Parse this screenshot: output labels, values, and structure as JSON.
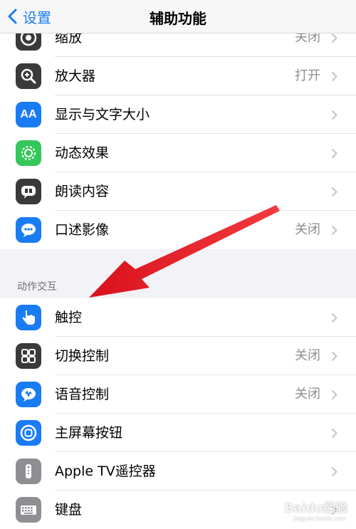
{
  "nav": {
    "back_label": "设置",
    "title": "辅助功能"
  },
  "colors": {
    "accent": "#1a7cf5",
    "arrow": "#e8202b"
  },
  "groups": {
    "vision": [
      {
        "label": "缩放",
        "value": "关闭",
        "icon": "zoom-icon"
      },
      {
        "label": "放大器",
        "value": "打开",
        "icon": "magnifier-icon"
      },
      {
        "label": "显示与文字大小",
        "value": "",
        "icon": "text-size-icon"
      },
      {
        "label": "动态效果",
        "value": "",
        "icon": "motion-icon"
      },
      {
        "label": "朗读内容",
        "value": "",
        "icon": "spoken-content-icon"
      },
      {
        "label": "口述影像",
        "value": "关闭",
        "icon": "audio-description-icon"
      }
    ],
    "interaction_header": "动作交互",
    "interaction": [
      {
        "label": "触控",
        "value": "",
        "icon": "touch-hand-icon"
      },
      {
        "label": "切换控制",
        "value": "关闭",
        "icon": "switch-control-icon"
      },
      {
        "label": "语音控制",
        "value": "关闭",
        "icon": "voice-control-icon"
      },
      {
        "label": "主屏幕按钮",
        "value": "",
        "icon": "home-button-icon"
      },
      {
        "label": "Apple TV遥控器",
        "value": "",
        "icon": "apple-tv-remote-icon"
      },
      {
        "label": "键盘",
        "value": "",
        "icon": "keyboard-icon"
      }
    ]
  },
  "watermark": {
    "main": "Baidu经验",
    "sub": "jingyan.baidu.com"
  }
}
